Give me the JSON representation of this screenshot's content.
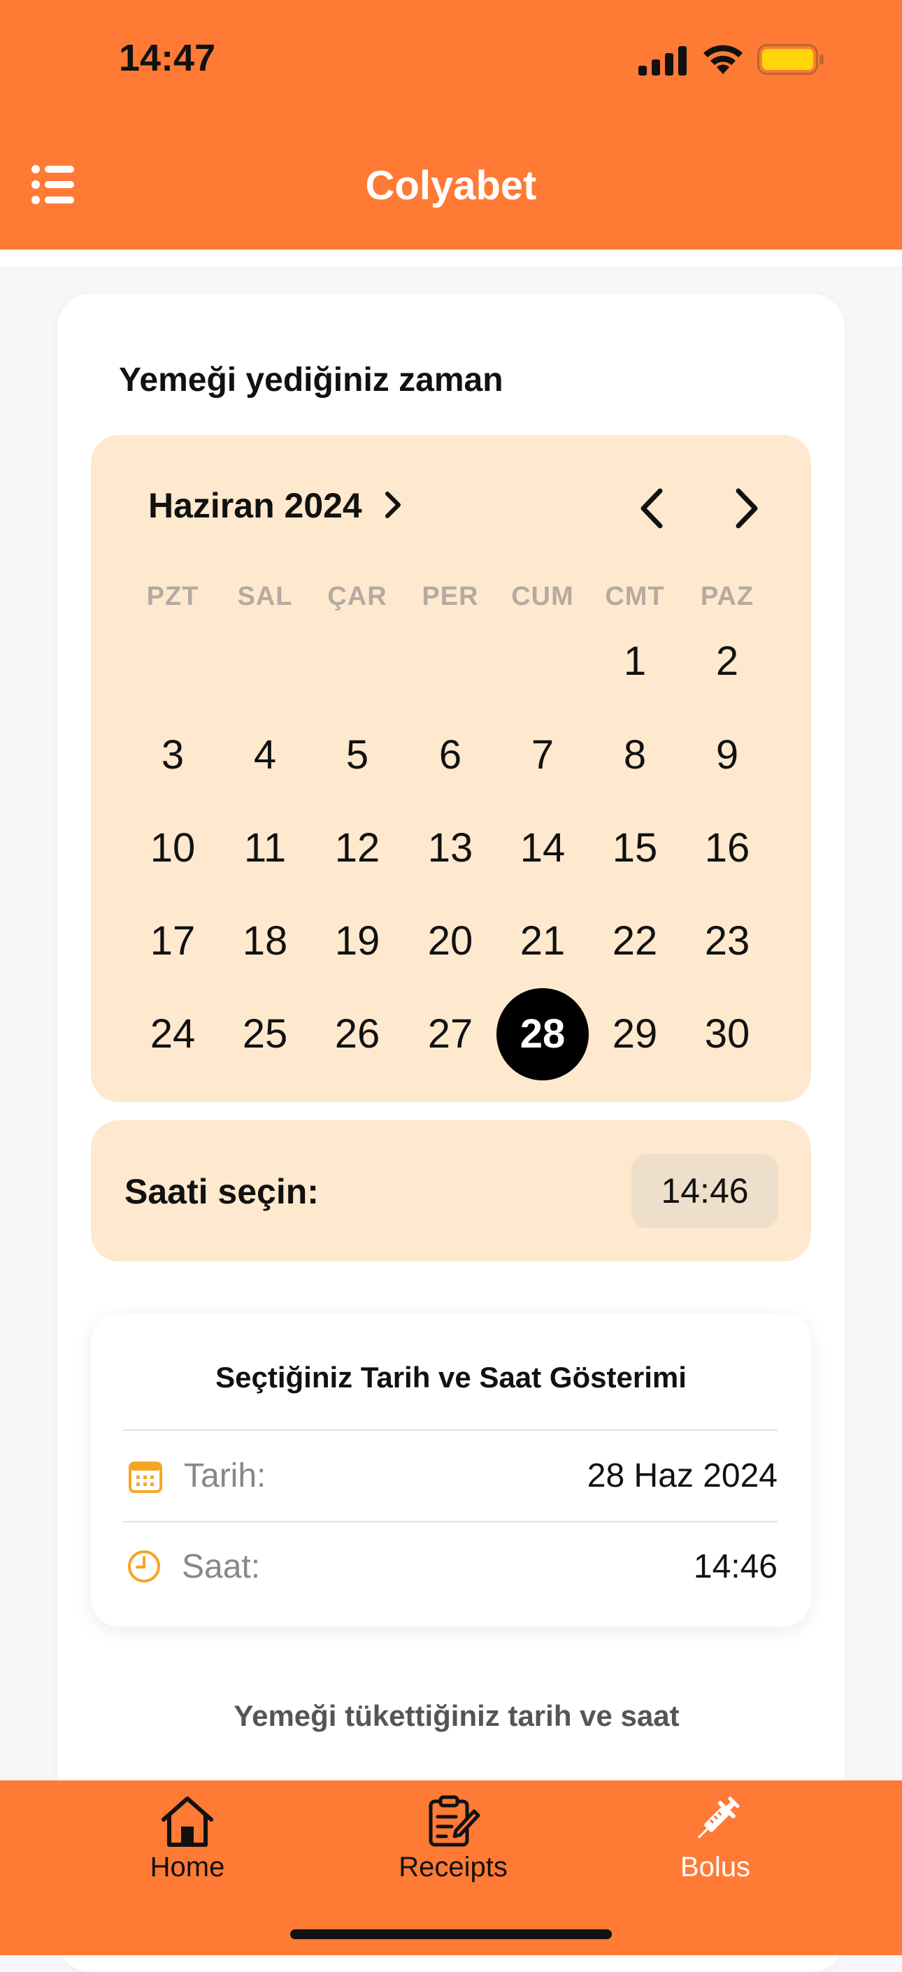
{
  "status_bar": {
    "time": "14:47"
  },
  "header": {
    "title": "Colyabet"
  },
  "section_heading": "Yemeği yediğiniz zaman",
  "calendar": {
    "month_label": "Haziran 2024",
    "weekdays": [
      "PZT",
      "SAL",
      "ÇAR",
      "PER",
      "CUM",
      "CMT",
      "PAZ"
    ],
    "weeks": [
      [
        "",
        "",
        "",
        "",
        "",
        "1",
        "2"
      ],
      [
        "3",
        "4",
        "5",
        "6",
        "7",
        "8",
        "9"
      ],
      [
        "10",
        "11",
        "12",
        "13",
        "14",
        "15",
        "16"
      ],
      [
        "17",
        "18",
        "19",
        "20",
        "21",
        "22",
        "23"
      ],
      [
        "24",
        "25",
        "26",
        "27",
        "28",
        "29",
        "30"
      ]
    ],
    "selected_day": "28"
  },
  "time_picker": {
    "label": "Saati seçin:",
    "value": "14:46"
  },
  "summary": {
    "title": "Seçtiğiniz Tarih ve Saat Gösterimi",
    "date_label": "Tarih:",
    "date_value": "28 Haz 2024",
    "time_label": "Saat:",
    "time_value": "14:46"
  },
  "footnote": "Yemeği tükettiğiniz tarih ve saat",
  "tabs": [
    {
      "label": "Home",
      "icon": "home-icon",
      "active": false
    },
    {
      "label": "Receipts",
      "icon": "receipts-icon",
      "active": false
    },
    {
      "label": "Bolus",
      "icon": "syringe-icon",
      "active": true
    }
  ],
  "colors": {
    "accent": "#FF7A35",
    "calendar_bg": "#FEE9CF",
    "tab_active": "#FFFFFF",
    "tab_inactive": "#111111",
    "icon_accent": "#F5A623"
  }
}
